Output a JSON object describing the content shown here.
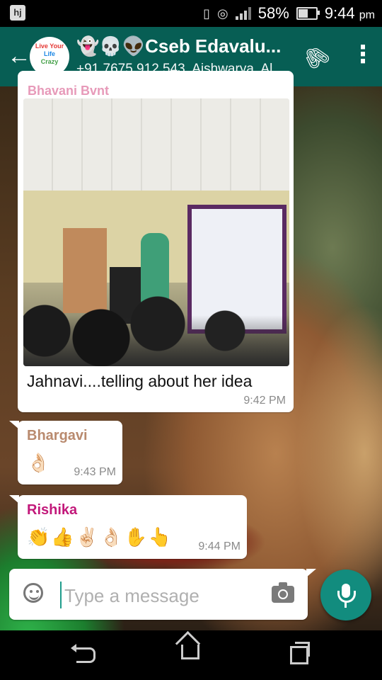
{
  "status_bar": {
    "app_icon": "hj",
    "battery": "58%",
    "battery_level": 0.58,
    "time": "9:44",
    "ampm": "pm"
  },
  "header": {
    "back_icon": "arrow-left",
    "title": "👻💀👽Cseb Edavalu...",
    "subtitle": "+91 7675 912 543, Aishwarya, Al...",
    "avatar_text": [
      "Live Your",
      "Life",
      "Crazy"
    ],
    "attach_icon": "paperclip",
    "menu_icon": "more-vertical"
  },
  "messages": [
    {
      "sender": "Bhavani Bvnt",
      "sender_color": "#e79ab9",
      "type": "image",
      "caption": "Jahnavi....telling about her idea",
      "time": "9:42 PM"
    },
    {
      "sender": "Bhargavi",
      "sender_color": "#b98a6e",
      "text": "👌🏻",
      "time": "9:43 PM"
    },
    {
      "sender": "Rishika",
      "sender_color": "#c2187a",
      "text": "👏👍✌🏻👌🏻✋👆",
      "time": "9:44 PM"
    }
  ],
  "composer": {
    "placeholder": "Type a message",
    "emoji_icon": "smiley",
    "camera_icon": "camera",
    "mic_icon": "microphone"
  },
  "colors": {
    "header_bg": "#075e54",
    "mic_bg": "#128c7e"
  }
}
